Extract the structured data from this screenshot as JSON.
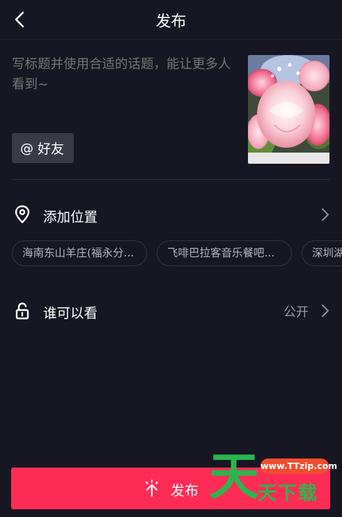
{
  "header": {
    "title": "发布",
    "back_icon": "back-chevron-icon"
  },
  "caption": {
    "placeholder": "写标题并使用合适的话题，能让更多人看到~",
    "value": ""
  },
  "cover": {
    "description_icon": "cover-thumbnail"
  },
  "mention": {
    "symbol": "@",
    "label": "好友"
  },
  "location": {
    "icon": "location-pin-icon",
    "label": "添加位置",
    "suggestions": [
      "海南东山羊庄(福永分...",
      "飞啡巴拉客音乐餐吧...",
      "深圳湖"
    ]
  },
  "visibility": {
    "icon": "unlock-icon",
    "label": "谁可以看",
    "value": "公开"
  },
  "publish": {
    "icon": "publish-arrow-icon",
    "label": "发布"
  },
  "watermark": {
    "big": "天",
    "url": "www.TTzip.com",
    "small": "天下载"
  },
  "colors": {
    "background": "#161722",
    "accent": "#fe2c55",
    "chip_border": "#34353f",
    "muted_text": "#8b8c93"
  }
}
